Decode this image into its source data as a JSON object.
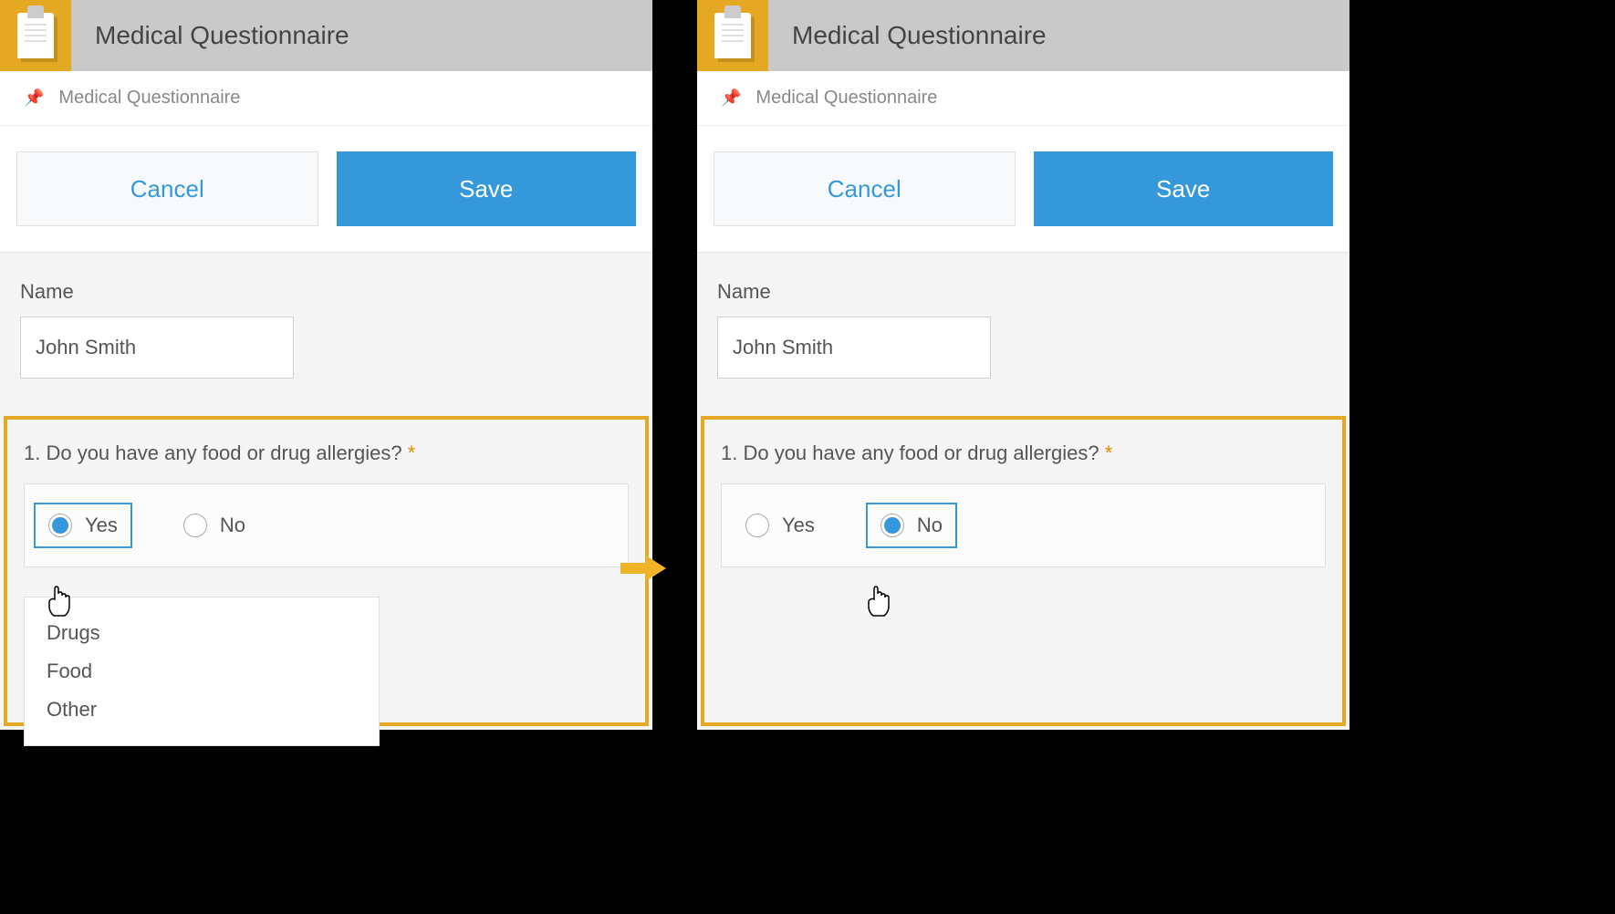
{
  "header": {
    "title": "Medical Questionnaire"
  },
  "breadcrumb": {
    "text": "Medical Questionnaire"
  },
  "actions": {
    "cancel_label": "Cancel",
    "save_label": "Save"
  },
  "form": {
    "name_label": "Name",
    "name_value": "John Smith"
  },
  "question": {
    "text": "1. Do you have any food or drug allergies? ",
    "required_marker": "*",
    "options": {
      "yes_label": "Yes",
      "no_label": "No"
    },
    "selected_left": "yes",
    "selected_right": "no",
    "followup_items": [
      "Drugs",
      "Food",
      "Other"
    ]
  }
}
